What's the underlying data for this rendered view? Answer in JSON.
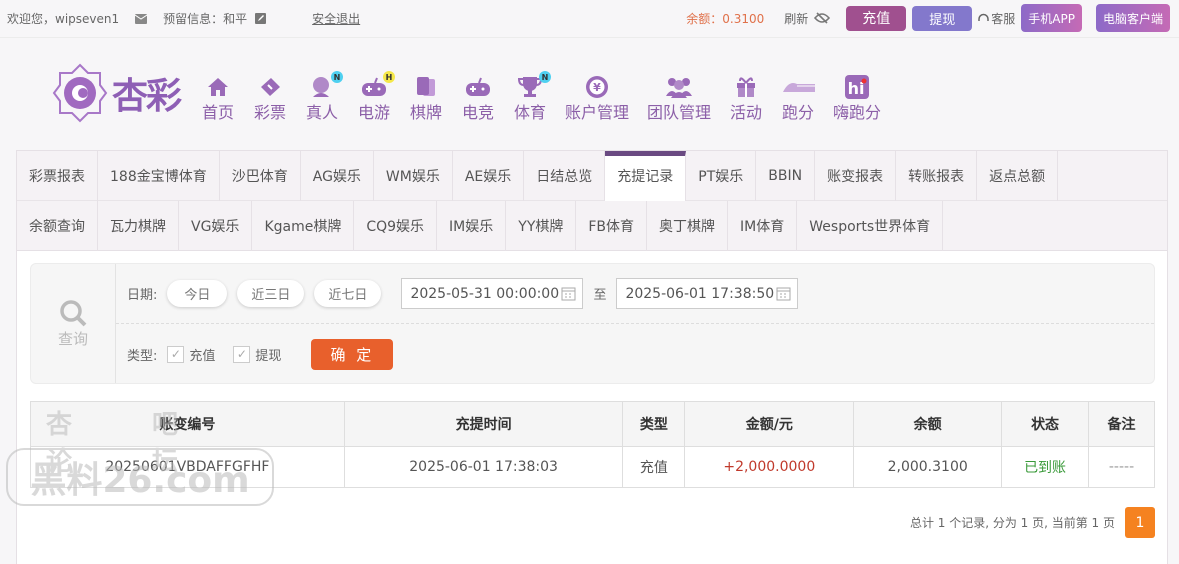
{
  "topbar": {
    "welcome": "欢迎您，wipseven1",
    "reserved": "预留信息：和平",
    "logout": "安全退出",
    "balance": "余额：0.3100",
    "refresh": "刷新",
    "deposit": "充值",
    "withdraw": "提现",
    "service": "客服",
    "mobile_app": "手机APP",
    "pc_client": "电脑客户端"
  },
  "logo": {
    "text": "杏彩"
  },
  "nav": [
    {
      "label": "首页",
      "icon": "home-icon"
    },
    {
      "label": "彩票",
      "icon": "ticket-icon"
    },
    {
      "label": "真人",
      "icon": "live-dealer-icon",
      "badge": "N"
    },
    {
      "label": "电游",
      "icon": "gamepad-icon",
      "badge": "H"
    },
    {
      "label": "棋牌",
      "icon": "cards-icon"
    },
    {
      "label": "电竞",
      "icon": "gamepad-icon"
    },
    {
      "label": "体育",
      "icon": "trophy-icon",
      "badge": "N"
    },
    {
      "label": "账户管理",
      "icon": "yen-coin-icon"
    },
    {
      "label": "团队管理",
      "icon": "team-icon"
    },
    {
      "label": "活动",
      "icon": "gift-icon"
    },
    {
      "label": "跑分",
      "icon": "paofen-icon"
    },
    {
      "label": "嗨跑分",
      "icon": "hi-icon"
    }
  ],
  "tabs_row1": [
    "彩票报表",
    "188金宝博体育",
    "沙巴体育",
    "AG娱乐",
    "WM娱乐",
    "AE娱乐",
    "日结总览",
    "充提记录",
    "PT娱乐",
    "BBIN",
    "账变报表",
    "转账报表",
    "返点总额"
  ],
  "tabs_row2": [
    "余额查询",
    "瓦力棋牌",
    "VG娱乐",
    "Kgame棋牌",
    "CQ9娱乐",
    "IM娱乐",
    "YY棋牌",
    "FB体育",
    "奥丁棋牌",
    "IM体育",
    "Wesports世界体育"
  ],
  "active_tab": "充提记录",
  "query": {
    "label": "查询",
    "date_label": "日期:",
    "today": "今日",
    "three_days": "近三日",
    "seven_days": "近七日",
    "start": "2025-05-31 00:00:00",
    "to": "至",
    "end": "2025-06-01 17:38:50",
    "type_label": "类型:",
    "type_deposit": "充值",
    "type_withdraw": "提现",
    "deposit_checked": true,
    "withdraw_checked": true,
    "confirm": "确 定"
  },
  "table": {
    "headers": [
      "账变编号",
      "充提时间",
      "类型",
      "金额/元",
      "余额",
      "状态",
      "备注"
    ],
    "rows": [
      [
        "20250601VBDAFFGFHF",
        "2025-06-01 17:38:03",
        "充值",
        "+2,000.0000",
        "2,000.3100",
        "已到账",
        "-----"
      ]
    ]
  },
  "pager": {
    "summary": "总计 1 个记录, 分为 1 页, 当前第 1 页",
    "current": "1"
  },
  "watermark": {
    "line1": "杏吧论坛",
    "line2": "黑料26.com"
  },
  "colors": {
    "brand": "#8e5fb5",
    "deposit_btn": "#a0508f",
    "withdraw_btn": "#8378cc",
    "confirm": "#e8602c",
    "amount": "#c0392b",
    "status": "#3a9a3a",
    "pager": "#f58220"
  }
}
